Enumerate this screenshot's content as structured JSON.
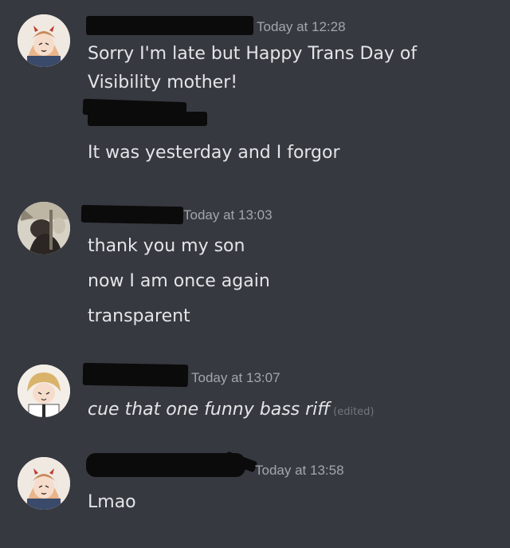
{
  "messages": [
    {
      "author_avatar": "anime-girl-horns-avatar",
      "timestamp": "Today at 12:28",
      "lines": [
        "Sorry I'm late but Happy Trans Day of",
        "Visibility mother!"
      ]
    },
    {
      "author_avatar": "anime-girl-horns-avatar",
      "timestamp": "",
      "lines": [
        "It was yesterday and I forgor"
      ]
    },
    {
      "author_avatar": "dark-character-avatar",
      "timestamp": "Today at 13:03",
      "lines": [
        "thank you my son",
        "now I am once again",
        "transparent"
      ]
    },
    {
      "author_avatar": "blonde-boy-avatar",
      "timestamp": "Today at 13:07",
      "lines": [
        "cue that one funny bass riff"
      ],
      "edited": "(edited)"
    },
    {
      "author_avatar": "anime-girl-horns-avatar",
      "timestamp": "Today at 13:58",
      "lines": [
        "Lmao"
      ]
    }
  ]
}
